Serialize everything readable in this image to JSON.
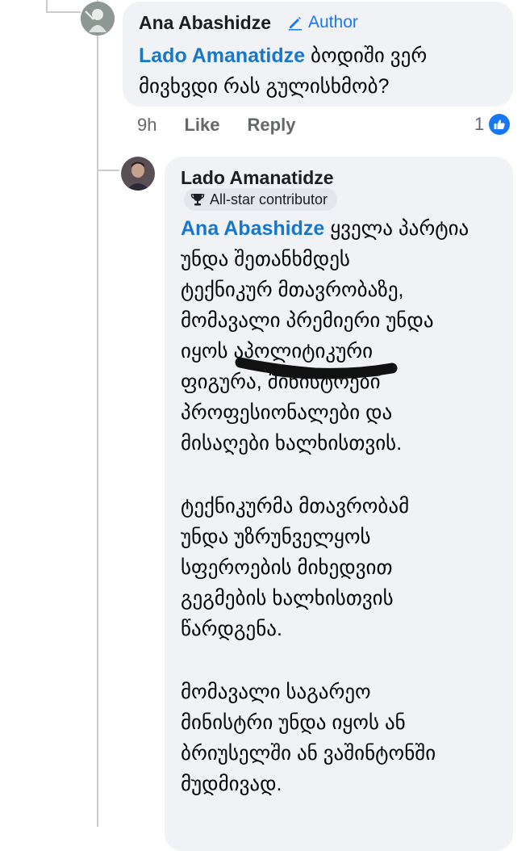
{
  "comment1": {
    "author": "Ana Abashidze",
    "badge": "Author",
    "mention": "Lado Amanatidze",
    "text_line1": "ბოდიში ვერ",
    "text_line2": "მივხვდი რას გულისხმობ?",
    "time": "9h",
    "like_label": "Like",
    "reply_label": "Reply",
    "reaction_count": "1"
  },
  "comment2": {
    "author": "Lado Amanatidze",
    "badge": "All-star contributor",
    "mention": "Ana Abashidze",
    "p1_first": "ყველა პარტია",
    "p1_lines": [
      "უნდა შეთანხმდეს",
      "ტექნიკურ მთავრობაზე,",
      "მომავალი პრემიერი უნდა",
      "იყოს აპოლიტიკური",
      "ფიგურა, მინისტრები",
      "პროფესიონალები და",
      "მისაღები ხალხისთვის."
    ],
    "p2_lines": [
      "ტექნიკურმა მთავრობამ",
      "უნდა უზრუნველყოს",
      "სფეროების მიხედვით",
      "გეგმების ხალხისთვის",
      "წარდგენა."
    ],
    "p3_lines": [
      "მომავალი საგარეო",
      "მინისტრი უნდა იყოს ან",
      "ბრიუსელში ან ვაშინტონში",
      "მუდმივად."
    ]
  },
  "colors": {
    "link": "#1877c8",
    "bubble": "#f0f2f5",
    "meta": "#65676b",
    "scribble": "#111111"
  }
}
